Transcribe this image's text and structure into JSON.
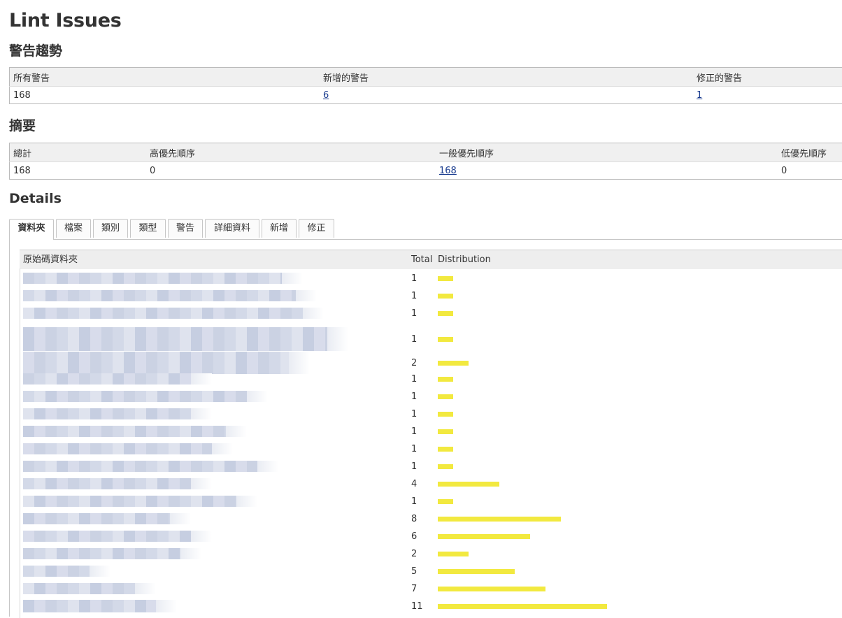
{
  "page": {
    "title": "Lint Issues"
  },
  "trend": {
    "heading": "警告趨勢",
    "columns": [
      "所有警告",
      "新增的警告",
      "修正的警告"
    ],
    "values": {
      "all": "168",
      "new": "6",
      "fixed": "1"
    }
  },
  "summary": {
    "heading": "摘要",
    "columns": [
      "總計",
      "高優先順序",
      "一般優先順序",
      "低優先順序"
    ],
    "values": {
      "total": "168",
      "high": "0",
      "normal": "168",
      "low": "0"
    }
  },
  "details": {
    "heading": "Details",
    "tabs": [
      "資料夾",
      "檔案",
      "類別",
      "類型",
      "警告",
      "詳細資料",
      "新增",
      "修正"
    ],
    "active_tab": "資料夾",
    "table": {
      "columns": [
        "原始碼資料夾",
        "Total",
        "Distribution"
      ],
      "rows": [
        {
          "total": 1
        },
        {
          "total": 1
        },
        {
          "total": 1
        },
        {
          "total": 1
        },
        {
          "total": 2
        },
        {
          "total": 1
        },
        {
          "total": 1
        },
        {
          "total": 1
        },
        {
          "total": 1
        },
        {
          "total": 1
        },
        {
          "total": 1
        },
        {
          "total": 4
        },
        {
          "total": 1
        },
        {
          "total": 8
        },
        {
          "total": 6
        },
        {
          "total": 2
        },
        {
          "total": 5
        },
        {
          "total": 7
        },
        {
          "total": 11
        }
      ]
    }
  },
  "colors": {
    "bar": "#f2e93f",
    "link": "#1a3c8f",
    "redacted": "#cfd6e6"
  }
}
